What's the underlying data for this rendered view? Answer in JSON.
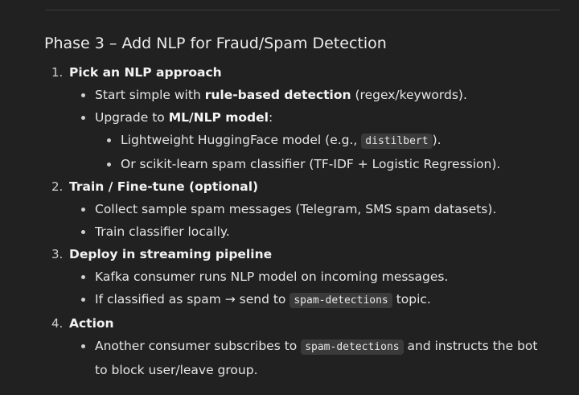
{
  "section": {
    "title": "Phase 3 – Add NLP for Fraud/Spam Detection"
  },
  "steps": [
    {
      "number": "1.",
      "title": "Pick an NLP approach",
      "item1": {
        "pre": "Start simple with ",
        "bold": "rule-based detection",
        "post": " (regex/keywords)."
      },
      "item2": {
        "pre": "Upgrade to ",
        "bold": "ML/NLP model",
        "post": ":",
        "sub1": {
          "pre": "Lightweight HuggingFace model (e.g., ",
          "code": "distilbert",
          "post": ")."
        },
        "sub2": {
          "text": "Or scikit-learn spam classifier (TF-IDF + Logistic Regression)."
        }
      }
    },
    {
      "number": "2.",
      "title": "Train / Fine-tune (optional)",
      "item1": {
        "text": "Collect sample spam messages (Telegram, SMS spam datasets)."
      },
      "item2": {
        "text": "Train classifier locally."
      }
    },
    {
      "number": "3.",
      "title": "Deploy in streaming pipeline",
      "item1": {
        "text": "Kafka consumer runs NLP model on incoming messages."
      },
      "item2": {
        "pre": "If classified as spam → send to ",
        "code": "spam-detections",
        "post": " topic."
      }
    },
    {
      "number": "4.",
      "title": "Action",
      "item1": {
        "pre": "Another consumer subscribes to ",
        "code": "spam-detections",
        "post": " and instructs the bot to block user/leave group."
      }
    }
  ]
}
